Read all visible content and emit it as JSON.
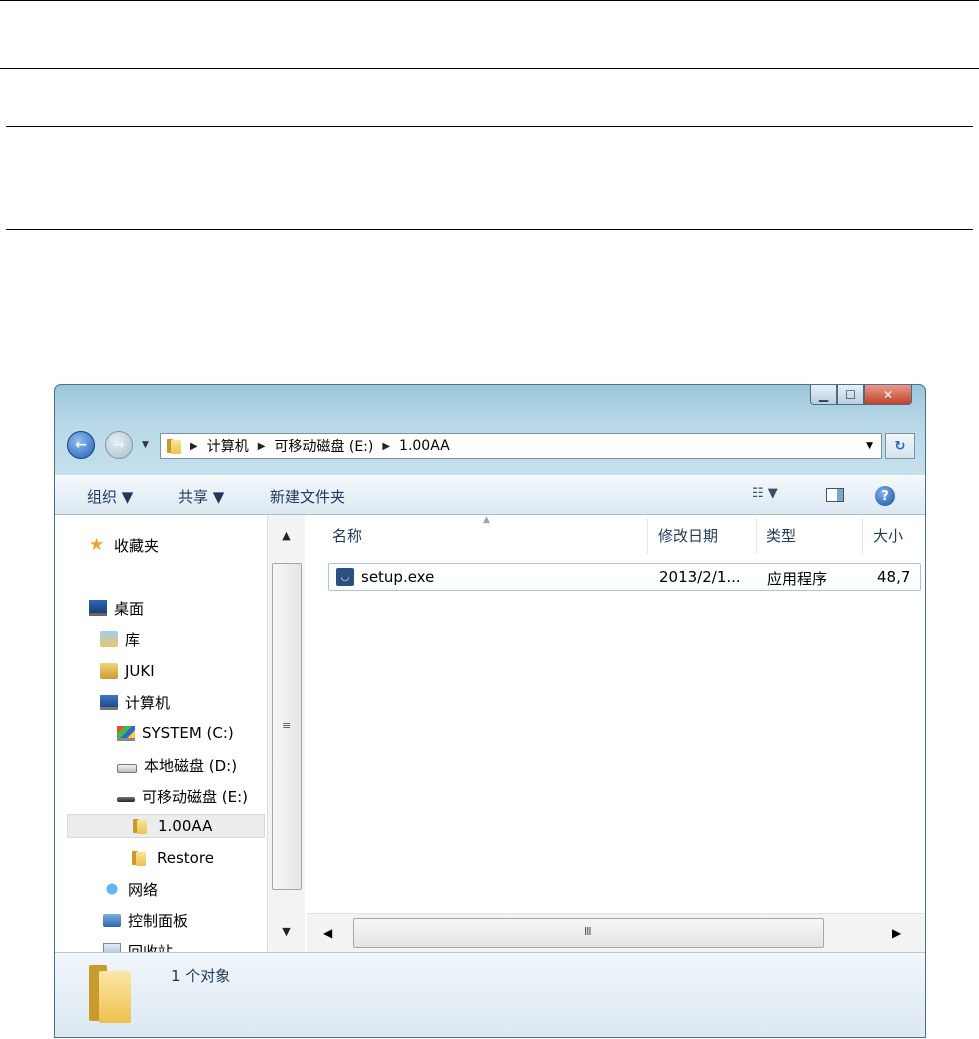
{
  "window": {
    "controls": {
      "minimize": "▁",
      "maximize": "☐",
      "close": "✕"
    }
  },
  "address_bar": {
    "breadcrumbs": [
      "计算机",
      "可移动磁盘 (E:)",
      "1.00AA"
    ]
  },
  "toolbar": {
    "organize": "组织 ▼",
    "share": "共享 ▼",
    "new_folder": "新建文件夹",
    "view_icon": "view-options-icon",
    "pane_icon": "preview-pane-icon",
    "help_icon": "help-icon"
  },
  "sidebar": {
    "favorites": "收藏夹",
    "desktop": "桌面",
    "library": "库",
    "user": "JUKI",
    "computer": "计算机",
    "drive_c": "SYSTEM (C:)",
    "drive_d": "本地磁盘 (D:)",
    "drive_e": "可移动磁盘 (E:)",
    "folder_selected": "1.00AA",
    "folder_restore": "Restore",
    "network": "网络",
    "control_panel": "控制面板",
    "recycle_bin": "回收站"
  },
  "file_list": {
    "columns": {
      "name": "名称",
      "date": "修改日期",
      "type": "类型",
      "size": "大小"
    },
    "rows": [
      {
        "name": "setup.exe",
        "date": "2013/2/1...",
        "type": "应用程序",
        "size": "48,7"
      }
    ]
  },
  "scrollbar": {
    "grip": "≡",
    "h_grip": "Ⅲ"
  },
  "details": {
    "status": "1 个对象"
  },
  "colors": {
    "window_frame": "#b9d9e8",
    "selection": "#a5c6e7",
    "close_button": "#c3432a"
  }
}
